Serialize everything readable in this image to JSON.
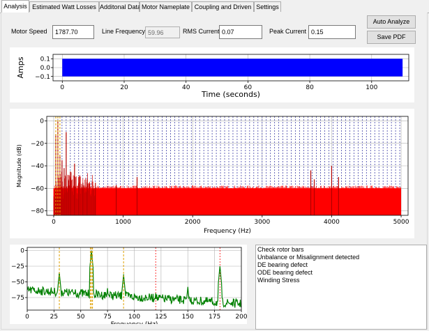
{
  "tabs": [
    {
      "label": "Analysis",
      "active": true
    },
    {
      "label": "Estimated Watt Losses",
      "active": false
    },
    {
      "label": "Additonal Data",
      "active": false
    },
    {
      "label": "Motor Nameplate",
      "active": false
    },
    {
      "label": "Coupling and Driven",
      "active": false
    },
    {
      "label": "Settings",
      "active": false
    }
  ],
  "fields": {
    "motor_speed": {
      "label": "Motor Speed",
      "value": "1787.70"
    },
    "line_frequency": {
      "label": "Line Frequency",
      "value": "59.96"
    },
    "rms_current": {
      "label": "RMS Current",
      "value": "0.07"
    },
    "peak_current": {
      "label": "Peak Current",
      "value": "0.15"
    }
  },
  "buttons": {
    "auto_analyze": "Auto Analyze",
    "save_pdf": "Save PDF"
  },
  "results": [
    "Check rotor bars",
    "Unbalance or Misalignment detected",
    "DE bearing defect",
    "ODE bearing defect",
    "Winding Stress"
  ],
  "colors": {
    "time_trace": "#0000ff",
    "spectrum": "#ff0000",
    "zoom": "#008000",
    "marker": "#e0a000",
    "guide": "#00008b"
  },
  "chart_data": [
    {
      "type": "line",
      "title": "",
      "xlabel": "Time (seconds)",
      "ylabel": "Amps",
      "xlim": [
        -3,
        112
      ],
      "ylim": [
        -0.15,
        0.15
      ],
      "xticks": [
        0,
        20,
        40,
        60,
        80,
        100
      ],
      "yticks": [
        0.1,
        0.0,
        -0.1
      ],
      "ytick_labels": [
        "0.1",
        "0.0",
        "−0.1"
      ],
      "grid": true,
      "series": [
        {
          "x": [
            0,
            110
          ],
          "y_min": -0.1,
          "y_max": 0.1
        }
      ]
    },
    {
      "type": "line",
      "title": "",
      "xlabel": "Frequency (Hz)",
      "ylabel": "Magnitude (dB)",
      "xlim": [
        -100,
        5100
      ],
      "ylim": [
        -84,
        4
      ],
      "xticks": [
        0,
        1000,
        2000,
        3000,
        4000,
        5000
      ],
      "yticks": [
        0,
        -20,
        -40,
        -60,
        -80
      ],
      "ytick_labels": [
        "0",
        "−20",
        "−40",
        "−60",
        "−80"
      ],
      "grid": true,
      "noise_floor_db": -60,
      "peaks": [
        {
          "f": 30,
          "db": -12
        },
        {
          "f": 60,
          "db": 0
        },
        {
          "f": 90,
          "db": -30
        },
        {
          "f": 120,
          "db": -35
        },
        {
          "f": 150,
          "db": -42
        },
        {
          "f": 180,
          "db": -10
        },
        {
          "f": 210,
          "db": -52
        },
        {
          "f": 240,
          "db": -45
        },
        {
          "f": 300,
          "db": -38
        },
        {
          "f": 360,
          "db": -50
        },
        {
          "f": 420,
          "db": -55
        },
        {
          "f": 480,
          "db": -52
        },
        {
          "f": 600,
          "db": -55
        },
        {
          "f": 900,
          "db": -57
        },
        {
          "f": 1200,
          "db": -50
        },
        {
          "f": 3700,
          "db": -44
        },
        {
          "f": 3750,
          "db": -52
        },
        {
          "f": 4000,
          "db": -40
        },
        {
          "f": 4100,
          "db": -50
        }
      ],
      "guide_lines_step_hz": 60,
      "marker_lines_hz": [
        30,
        60,
        90
      ]
    },
    {
      "type": "line",
      "title": "",
      "xlabel": "Frequency (Hz)",
      "ylabel": "",
      "xlim": [
        0,
        200
      ],
      "ylim": [
        -95,
        5
      ],
      "xticks": [
        0,
        25,
        50,
        75,
        100,
        125,
        150,
        175,
        200
      ],
      "yticks": [
        0,
        -25,
        -50,
        -75
      ],
      "ytick_labels": [
        "0",
        "−25",
        "−50",
        "−75"
      ],
      "grid": true,
      "peaks": [
        {
          "f": 30,
          "db": -35
        },
        {
          "f": 60,
          "db": 0
        },
        {
          "f": 90,
          "db": -38
        },
        {
          "f": 120,
          "db": -68
        },
        {
          "f": 150,
          "db": -58
        },
        {
          "f": 180,
          "db": -25
        },
        {
          "f": 12,
          "db": -62
        },
        {
          "f": 45,
          "db": -62
        },
        {
          "f": 75,
          "db": -60
        }
      ],
      "marker_lines_hz": [
        30,
        59,
        60,
        61,
        90
      ],
      "red_lines_hz": [
        120,
        180
      ]
    }
  ]
}
